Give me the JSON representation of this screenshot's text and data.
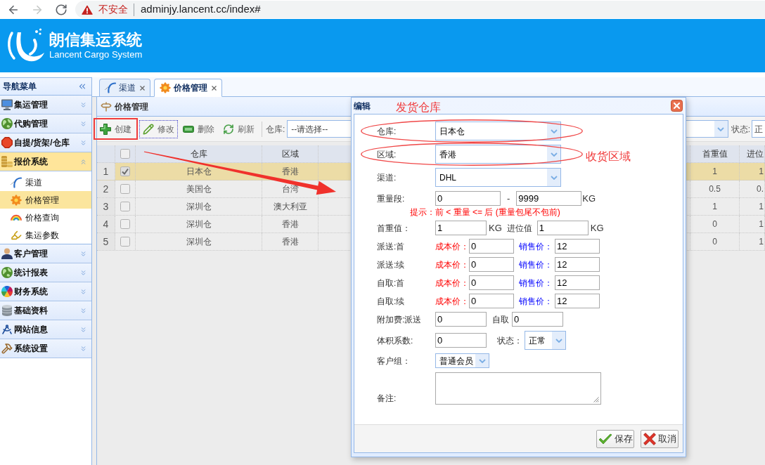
{
  "browser": {
    "nav": [
      {
        "kind": "back",
        "disabled": false
      },
      {
        "kind": "forward",
        "disabled": true
      },
      {
        "kind": "reload",
        "disabled": false
      }
    ],
    "security": "不安全",
    "url": "adminjy.lancent.cc/index#"
  },
  "header": {
    "title": "朗信集运系统",
    "subtitle": "Lancent Cargo System"
  },
  "sidebar": {
    "title": "导航菜单",
    "items": [
      {
        "label": "集运管理",
        "expanded": false
      },
      {
        "label": "代购管理",
        "expanded": false
      },
      {
        "label": "自提/货架/仓库",
        "expanded": false
      },
      {
        "label": "报价系统",
        "expanded": true,
        "children": [
          {
            "label": "渠道",
            "selected": false
          },
          {
            "label": "价格管理",
            "selected": true
          },
          {
            "label": "价格查询",
            "selected": false
          },
          {
            "label": "集运参数",
            "selected": false
          }
        ]
      },
      {
        "label": "客户管理",
        "expanded": false
      },
      {
        "label": "统计报表",
        "expanded": false
      },
      {
        "label": "财务系统",
        "expanded": false
      },
      {
        "label": "基础资料",
        "expanded": false
      },
      {
        "label": "网站信息",
        "expanded": false
      },
      {
        "label": "系统设置",
        "expanded": false
      }
    ]
  },
  "tabs": [
    {
      "label": "渠道",
      "selected": false
    },
    {
      "label": "价格管理",
      "selected": true
    }
  ],
  "panel": {
    "title": "价格管理",
    "toolbar": [
      {
        "label": "创建",
        "focused": false,
        "marked": true
      },
      {
        "label": "修改",
        "focused": true,
        "marked": false
      },
      {
        "label": "删除",
        "focused": false,
        "marked": false
      },
      {
        "label": "刷新",
        "focused": false,
        "marked": false
      }
    ],
    "filters": [
      {
        "kind": "select",
        "label": "仓库:",
        "value": "--请选择--"
      },
      {
        "kind": "covered_select"
      },
      {
        "kind": "cut_select",
        "label": "状态:",
        "value": "正"
      }
    ],
    "table": {
      "all_checked": false,
      "columns": [
        "仓库",
        "区域",
        "首重值",
        "进位"
      ],
      "rows": [
        {
          "number": "1",
          "checked": true,
          "selected": true,
          "cells": [
            "日本仓",
            "香港",
            "1",
            "1"
          ]
        },
        {
          "number": "2",
          "checked": false,
          "selected": false,
          "cells": [
            "美国仓",
            "台湾",
            "0.5",
            "0."
          ]
        },
        {
          "number": "3",
          "checked": false,
          "selected": false,
          "cells": [
            "深圳仓",
            "澳大利亚",
            "1",
            "1"
          ]
        },
        {
          "number": "4",
          "checked": false,
          "selected": false,
          "cells": [
            "深圳仓",
            "香港",
            "0",
            "1"
          ]
        },
        {
          "number": "5",
          "checked": false,
          "selected": false,
          "cells": [
            "深圳仓",
            "香港",
            "0",
            "1"
          ]
        }
      ]
    }
  },
  "dialog": {
    "title": "编辑",
    "note": "发货仓库",
    "fields": [
      {
        "kind": "select",
        "label": "仓库:",
        "value": "日本仓",
        "circled": true
      },
      {
        "kind": "select",
        "label": "区域:",
        "value": "香港",
        "circled": true,
        "note": "收货区域"
      },
      {
        "kind": "select",
        "label": "渠道:",
        "value": "DHL",
        "circled": false
      },
      {
        "kind": "range",
        "label": "重量段:",
        "from": "0",
        "separator": "-",
        "to": "9999",
        "unit": "KG",
        "circled": false
      },
      {
        "kind": "hint",
        "text": "提示：前 < 重量 <= 后 (重量包尾不包前)",
        "circled": false
      },
      {
        "kind": "pair",
        "label": "首重值：",
        "value": "1",
        "unit": "KG",
        "label2": "进位值",
        "value2": "1",
        "unit2": "KG",
        "circled": false
      },
      {
        "kind": "price",
        "label": "派送:首",
        "cost_label": "成本价：",
        "cost": "0",
        "sale_label": "销售价：",
        "sale": "12",
        "circled": false
      },
      {
        "kind": "price",
        "label": "派送:续",
        "cost_label": "成本价：",
        "cost": "0",
        "sale_label": "销售价：",
        "sale": "12",
        "circled": false
      },
      {
        "kind": "price",
        "label": "自取:首",
        "cost_label": "成本价：",
        "cost": "0",
        "sale_label": "销售价：",
        "sale": "12",
        "circled": false
      },
      {
        "kind": "price",
        "label": "自取:续",
        "cost_label": "成本价：",
        "cost": "0",
        "sale_label": "销售价：",
        "sale": "12",
        "circled": false
      },
      {
        "kind": "pair",
        "label": "附加费:派送",
        "value": "0",
        "label2": "自取",
        "value2": "0",
        "circled": false
      },
      {
        "kind": "input_select",
        "label": "体积系数:",
        "value": "0",
        "label2": "状态：",
        "value2": "正常",
        "circled": false
      },
      {
        "kind": "small_select",
        "label": "客户组：",
        "value": "普通会员",
        "circled": false
      },
      {
        "kind": "textarea",
        "label": "备注:",
        "circled": false
      }
    ],
    "buttons": [
      {
        "label": "保存"
      },
      {
        "label": "取消"
      }
    ]
  }
}
